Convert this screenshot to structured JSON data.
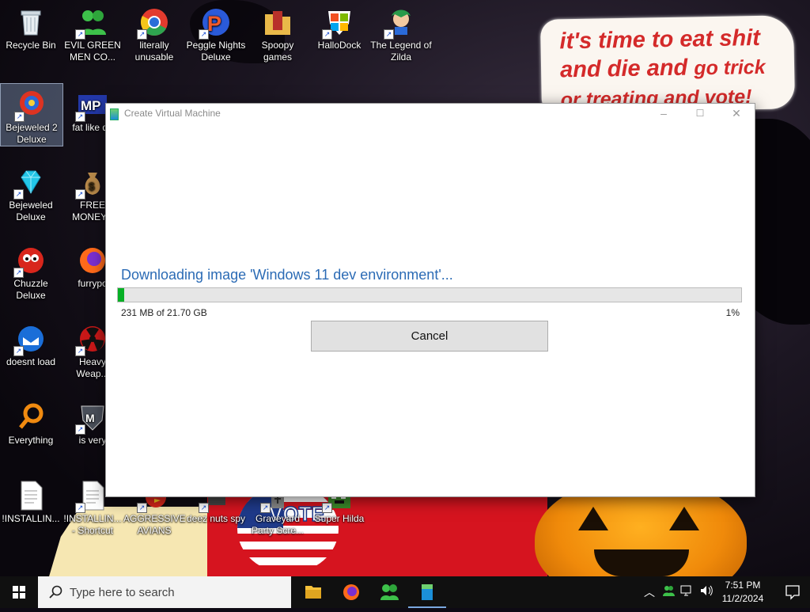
{
  "wallpaper": {
    "bubble_line1": "it's time to eat shit",
    "bubble_line2a": "and die and",
    "bubble_line2b": "go trick",
    "bubble_line3": "or treating and vote!",
    "vote_text": "VOTE"
  },
  "desktop_icons": [
    {
      "label": "Recycle Bin"
    },
    {
      "label": "EVIL GREEN MEN CO..."
    },
    {
      "label": "literally unusable"
    },
    {
      "label": "Peggle Nights Deluxe"
    },
    {
      "label": "Spoopy games"
    },
    {
      "label": "HalloDock"
    },
    {
      "label": "The Legend of Zilda"
    },
    {
      "label": "Bejeweled 2 Deluxe"
    },
    {
      "label": "fat like da"
    },
    {
      "label": "Bejeweled Deluxe"
    },
    {
      "label": "FREE MONEY.c"
    },
    {
      "label": "Chuzzle Deluxe"
    },
    {
      "label": "furrypo"
    },
    {
      "label": "doesnt load"
    },
    {
      "label": "Heavy Weap..."
    },
    {
      "label": "Everything"
    },
    {
      "label": "is very"
    },
    {
      "label": "!INSTALLIN..."
    },
    {
      "label": "!INSTALLIN... - Shortcut"
    },
    {
      "label": "AGGRESSIVE AVIANS"
    },
    {
      "label": "deez nuts spy"
    },
    {
      "label": "Graveyard Party Scre..."
    },
    {
      "label": "Super Hilda"
    }
  ],
  "window": {
    "title": "Create Virtual Machine",
    "status": "Downloading image 'Windows 11 dev environment'...",
    "progress_fraction": 0.01,
    "bytes": "231 MB of 21.70 GB",
    "percent": "1%",
    "cancel_label": "Cancel"
  },
  "taskbar": {
    "search_placeholder": "Type here to search",
    "time": "7:51 PM",
    "date": "11/2/2024"
  }
}
